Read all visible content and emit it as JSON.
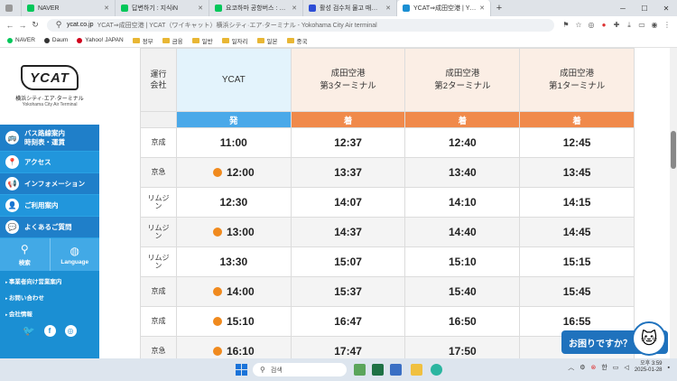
{
  "browser": {
    "tabs": [
      {
        "label": "",
        "fav_color": "#999999"
      },
      {
        "label": "NAVER",
        "fav_color": "#03c75a"
      },
      {
        "label": "답변하기 : 지식iN",
        "fav_color": "#03c75a"
      },
      {
        "label": "요코하마 공항버스 : 지식iN",
        "fav_color": "#03c75a"
      },
      {
        "label": "활성 검수처 물고 매치지 | 미...",
        "fav_color": "#2d4dd6"
      },
      {
        "label": "YCAT⇒成田空港 | YCAT（ワ...",
        "fav_color": "#1b8fd3"
      }
    ],
    "address": {
      "host": "ycat.co.jp",
      "rest": "YCAT⇒成田空港 | YCAT（ワイキャット）横浜シティ·エア·ターミナル - Yokohama City Air terminal"
    },
    "bookmarks": [
      {
        "label": "NAVER",
        "type": "dot",
        "color": "#03c75a"
      },
      {
        "label": "Daum",
        "type": "dot",
        "color": "#333333"
      },
      {
        "label": "Yahoo! JAPAN",
        "type": "dot",
        "color": "#d0021b"
      },
      {
        "label": "정부",
        "type": "folder"
      },
      {
        "label": "금융",
        "type": "folder"
      },
      {
        "label": "일반",
        "type": "folder"
      },
      {
        "label": "일자리",
        "type": "folder"
      },
      {
        "label": "일본",
        "type": "folder"
      },
      {
        "label": "중국",
        "type": "folder"
      }
    ]
  },
  "sidebar": {
    "logo_text": "YCAT",
    "logo_jp": "横浜シティ·エア·ターミナル",
    "logo_en": "Yokohama City Air Terminal",
    "menu": [
      {
        "label1": "バス路線案内",
        "label2": "時刻表・運賃",
        "icon": "🚌"
      },
      {
        "label1": "アクセス",
        "label2": "",
        "icon": "📍"
      },
      {
        "label1": "インフォメーション",
        "label2": "",
        "icon": "📢"
      },
      {
        "label1": "ご利用案内",
        "label2": "",
        "icon": "👤"
      },
      {
        "label1": "よくあるご質問",
        "label2": "",
        "icon": "💬"
      }
    ],
    "search_label": "検索",
    "language_label": "Language",
    "links": [
      "事業者向け営業案内",
      "お問い合わせ",
      "会社情報"
    ]
  },
  "timetable": {
    "headers": {
      "company": "運行\n会社",
      "origin": "YCAT",
      "dest": [
        "成田空港\n第3ターミナル",
        "成田空港\n第2ターミナル",
        "成田空港\n第1ターミナル"
      ]
    },
    "sub": {
      "depart": "発",
      "arrive": "着"
    },
    "rows": [
      {
        "company": "京成",
        "dep": "11:00",
        "dot": false,
        "t3": "12:37",
        "t2": "12:40",
        "t1": "12:45"
      },
      {
        "company": "京急",
        "dep": "12:00",
        "dot": true,
        "t3": "13:37",
        "t2": "13:40",
        "t1": "13:45"
      },
      {
        "company": "リムジ\nン",
        "dep": "12:30",
        "dot": false,
        "t3": "14:07",
        "t2": "14:10",
        "t1": "14:15"
      },
      {
        "company": "リムジ\nン",
        "dep": "13:00",
        "dot": true,
        "t3": "14:37",
        "t2": "14:40",
        "t1": "14:45"
      },
      {
        "company": "リムジ\nン",
        "dep": "13:30",
        "dot": false,
        "t3": "15:07",
        "t2": "15:10",
        "t1": "15:15"
      },
      {
        "company": "京成",
        "dep": "14:00",
        "dot": true,
        "t3": "15:37",
        "t2": "15:40",
        "t1": "15:45"
      },
      {
        "company": "京成",
        "dep": "15:10",
        "dot": true,
        "t3": "16:47",
        "t2": "16:50",
        "t1": "16:55"
      },
      {
        "company": "京急",
        "dep": "16:10",
        "dot": true,
        "t3": "17:47",
        "t2": "17:50",
        "t1": ""
      }
    ]
  },
  "chat": {
    "label": "お困りですか？"
  },
  "taskbar": {
    "search_placeholder": "검색",
    "ime": "한",
    "time": "오후 3:59",
    "date": "2025-01-28"
  },
  "colors": {
    "depart": "#4aa9e9",
    "arrive": "#f08a4b",
    "sidebar": "#1b8fd3",
    "dot": "#f08a1e"
  }
}
